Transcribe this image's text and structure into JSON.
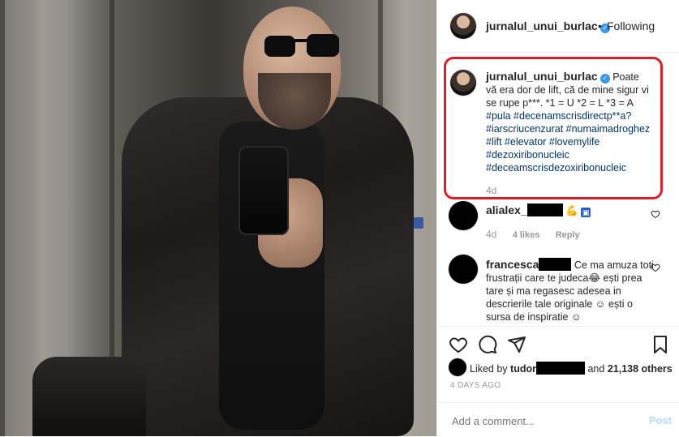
{
  "post": {
    "username": "jurnalul_unui_burlac",
    "follow_separator": "•",
    "follow_state": "Following",
    "verified_mark": "✓"
  },
  "caption": {
    "username": "jurnalul_unui_burlac",
    "text": "Poate vă era dor de lift, că de mine sigur vi se rupe p***. *1 = U *2 = L *3 = A",
    "hashtags": [
      "#pula #decenamscrisdirectp**a?",
      "#iarscriucenzurat #numaimadroghez",
      "#lift #elevator #lovemylife",
      "#dezoxiribonucleic",
      "#deceamscrisdezoxiribonucleic"
    ],
    "age": "4d"
  },
  "comments": [
    {
      "username_visible": "alialex_",
      "emoji": "💪",
      "badge": "▣",
      "age": "4d",
      "likes": "4 likes",
      "reply": "Reply"
    },
    {
      "username_visible": "francesca",
      "text": "Ce ma amuza toti frustrații care te judeca😂 ești prea tare și ma regasesc adesea in descrierile tale originale ☺ ești o sursa de inspiratie ☺"
    }
  ],
  "likes": {
    "prefix": "Liked by",
    "user_visible": "tudor",
    "connector": "and",
    "others": "21,138 others"
  },
  "date": "4 DAYS AGO",
  "add_comment": {
    "placeholder": "Add a comment...",
    "post_label": "Post"
  },
  "icons": {
    "heart": "heart-icon",
    "comment": "comment-icon",
    "share": "share-icon",
    "save": "bookmark-icon"
  },
  "colors": {
    "caption_highlight": "#d8202a",
    "hashtag": "#003569",
    "verified": "#3897f0"
  }
}
